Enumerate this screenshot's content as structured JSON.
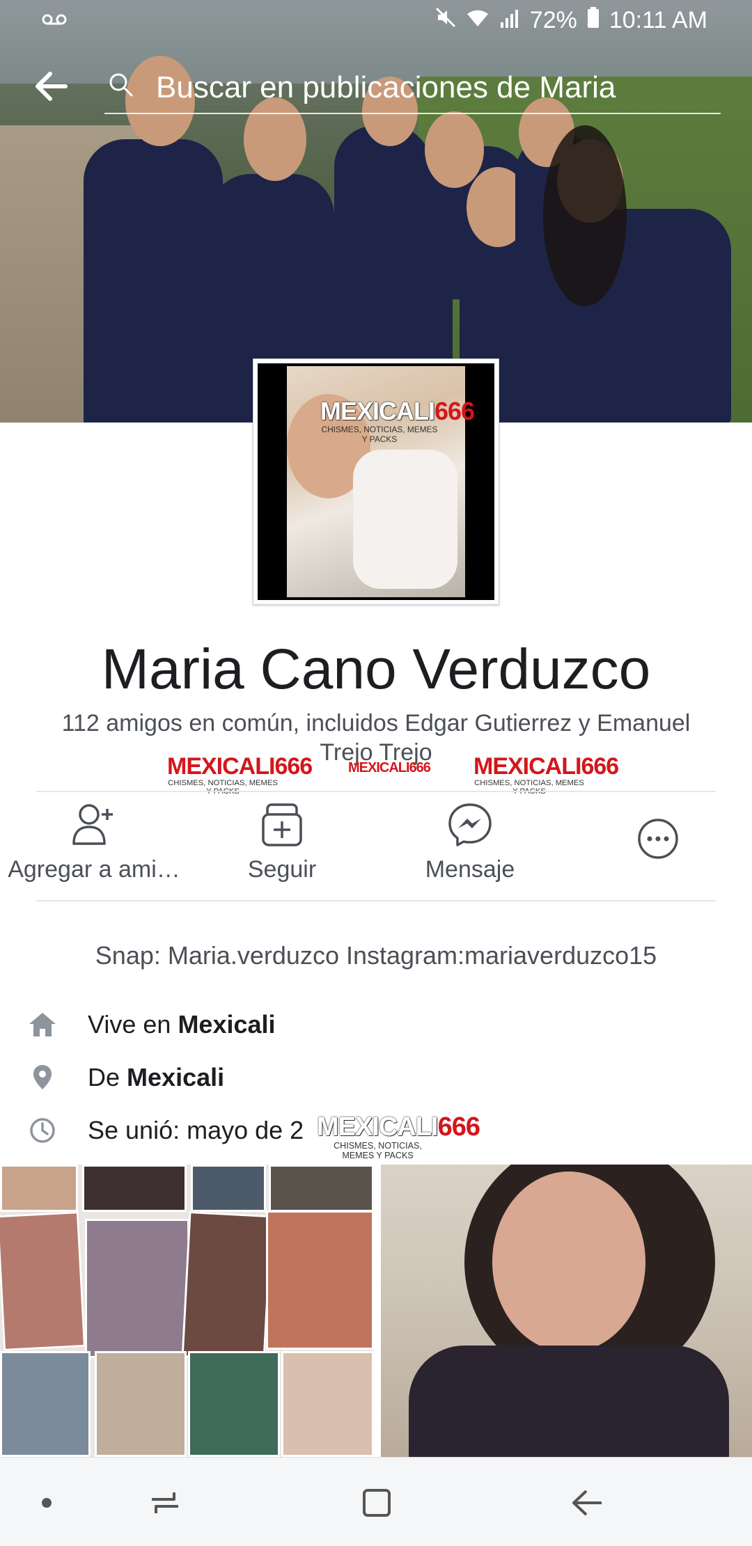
{
  "status_bar": {
    "left_icon": "voicemail-icon",
    "battery": "72%",
    "time": "10:11 AM"
  },
  "search": {
    "placeholder": "Buscar en publicaciones de Maria"
  },
  "watermark": {
    "brand_a": "MEXICALI",
    "brand_b": "666",
    "tagline": "CHISMES, NOTICIAS, MEMES Y PACKS"
  },
  "profile": {
    "name": "Maria Cano Verduzco",
    "mutual_friends": "112 amigos en común, incluidos Edgar Gutierrez y Emanuel Trejo Trejo"
  },
  "actions": [
    {
      "label": "Agregar a ami…",
      "icon": "add-friend-icon"
    },
    {
      "label": "Seguir",
      "icon": "follow-icon"
    },
    {
      "label": "Mensaje",
      "icon": "messenger-icon"
    },
    {
      "label": "",
      "icon": "more-icon"
    }
  ],
  "bio": "Snap: Maria.verduzco Instagram:mariaverduzco15",
  "intro": {
    "lives_prefix": "Vive en ",
    "lives_city": "Mexicali",
    "from_prefix": "De ",
    "from_city": "Mexicali",
    "joined": "Se unió: mayo de 2"
  },
  "colors": {
    "text_primary": "#1c1e21",
    "text_secondary": "#4b4f56",
    "icon_gray": "#8d949e",
    "watermark_red": "#d4161c"
  }
}
